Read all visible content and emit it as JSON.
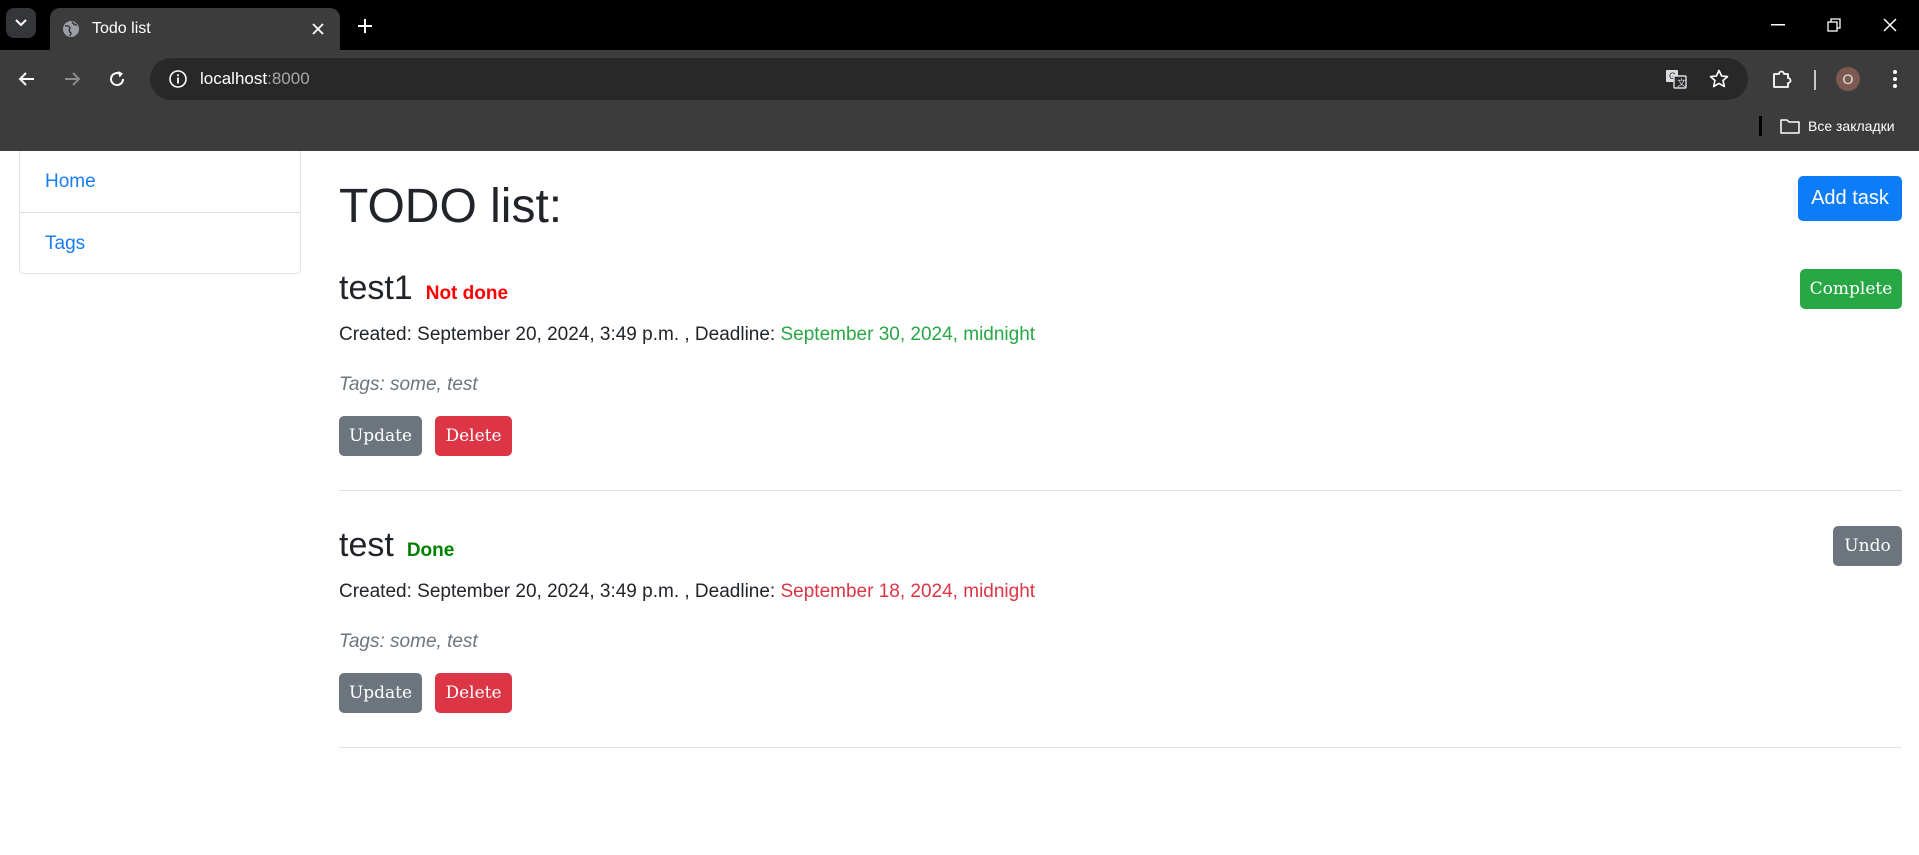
{
  "browser": {
    "tab_title": "Todo list",
    "url_host": "localhost",
    "url_port": ":8000",
    "profile_initial": "O",
    "bookmarks_all_label": "Все закладки",
    "icons": [
      "tab-search-icon",
      "globe-icon",
      "close-icon",
      "plus-icon",
      "minimize-icon",
      "restore-icon",
      "back-icon",
      "forward-icon",
      "reload-icon",
      "info-icon",
      "translate-icon",
      "star-icon",
      "extensions-icon",
      "menu-icon",
      "folder-icon"
    ]
  },
  "sidebar": {
    "items": [
      {
        "label": "Home"
      },
      {
        "label": "Tags"
      }
    ]
  },
  "main": {
    "title": "TODO list:",
    "add_task_label": "Add task"
  },
  "tasks": [
    {
      "name": "test1",
      "status": "Not done",
      "status_color": "#ff0000",
      "created_label": "Created: September 20, 2024, 3:49 p.m. , Deadline: ",
      "deadline": "September 30, 2024, midnight",
      "deadline_color": "#28a745",
      "tags": "Tags: some, test",
      "update_label": "Update",
      "delete_label": "Delete",
      "toggle_label": "Complete"
    },
    {
      "name": "test",
      "status": "Done",
      "status_color": "#008000",
      "created_label": "Created: September 20, 2024, 3:49 p.m. , Deadline: ",
      "deadline": "September 18, 2024, midnight",
      "deadline_color": "#dc3545",
      "tags": "Tags: some, test",
      "update_label": "Update",
      "delete_label": "Delete",
      "toggle_label": "Undo"
    }
  ],
  "colors": {
    "primary": "#0d7cf7",
    "success": "#28a745",
    "secondary": "#6c757d",
    "danger": "#dc3545",
    "link": "#1a7cf0"
  }
}
